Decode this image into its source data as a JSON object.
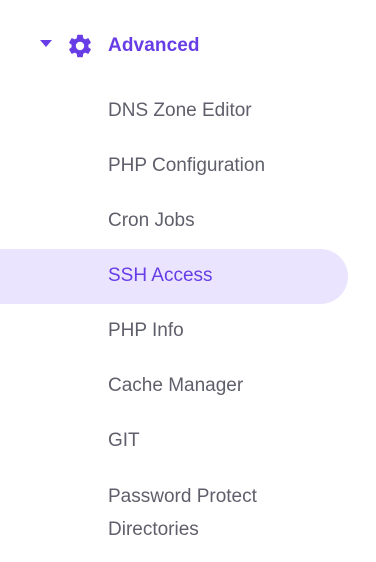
{
  "section": {
    "title": "Advanced",
    "icon": "gear-icon",
    "expand_icon": "caret-down-icon",
    "accent_color": "#673de6"
  },
  "menu": {
    "items": [
      {
        "label": "DNS Zone Editor",
        "active": false
      },
      {
        "label": "PHP Configuration",
        "active": false
      },
      {
        "label": "Cron Jobs",
        "active": false
      },
      {
        "label": "SSH Access",
        "active": true
      },
      {
        "label": "PHP Info",
        "active": false
      },
      {
        "label": "Cache Manager",
        "active": false
      },
      {
        "label": "GIT",
        "active": false
      },
      {
        "label": "Password Protect Directories",
        "active": false
      }
    ],
    "active_background": "#ebe4ff",
    "text_color": "#5f5f6b"
  }
}
